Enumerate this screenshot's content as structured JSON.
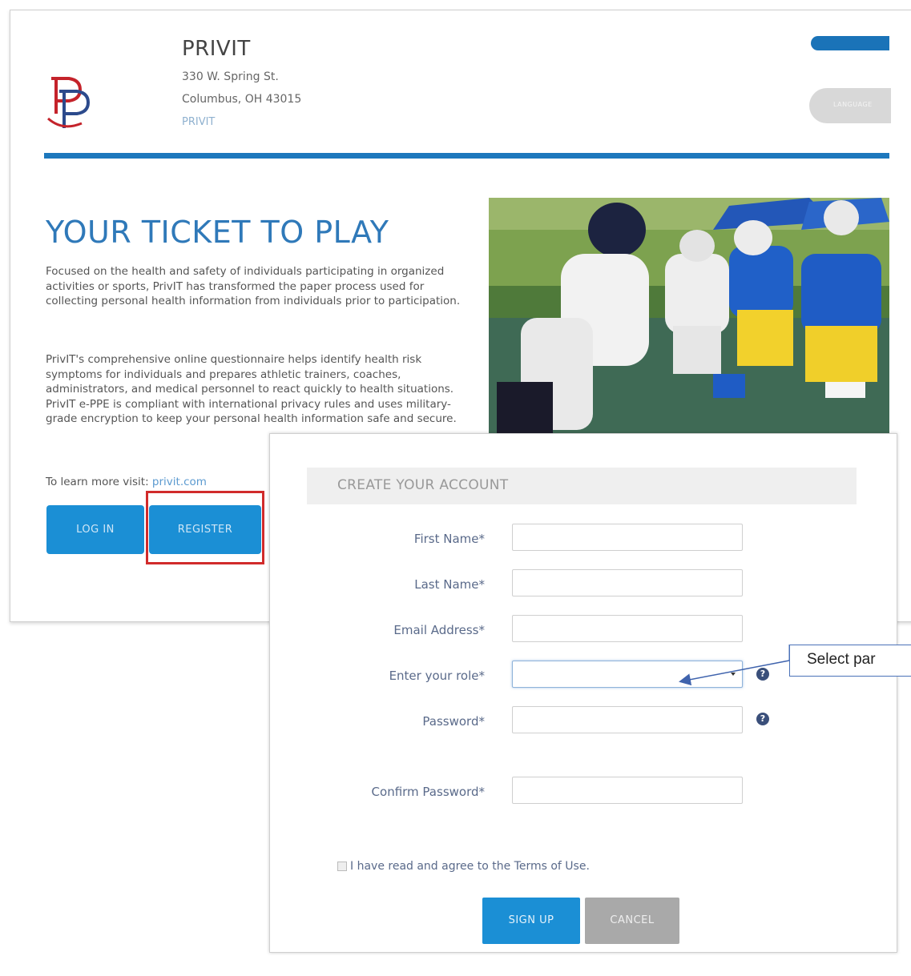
{
  "header": {
    "org_name": "PRIVIT",
    "address_line1": "330 W. Spring St.",
    "address_line2": "Columbus, OH 43015",
    "org_link": "PRIVIT",
    "top_grey_button": "LANGUAGE"
  },
  "hero": {
    "title": "YOUR TICKET TO PLAY",
    "paragraph1": "Focused on the health and safety of individuals participating in organized activities or sports, PrivIT has transformed the paper process used for collecting personal health information from individuals prior to participation.",
    "paragraph2": "PrivIT's comprehensive online questionnaire helps identify health risk symptoms for individuals and prepares athletic trainers, coaches, administrators, and medical personnel to react quickly to health situations. PrivIT e-PPE is compliant with international privacy rules and uses military-grade encryption to keep your personal health information safe and secure.",
    "learn_more_prefix": "To learn more visit: ",
    "learn_more_link": "privit.com"
  },
  "actions": {
    "login_label": "LOG IN",
    "register_label": "REGISTER"
  },
  "modal": {
    "title": "CREATE YOUR ACCOUNT",
    "fields": [
      {
        "label": "First Name*",
        "value": ""
      },
      {
        "label": "Last Name*",
        "value": ""
      },
      {
        "label": "Email Address*",
        "value": ""
      },
      {
        "label": "Enter your role*",
        "value": ""
      },
      {
        "label": "Password*",
        "value": ""
      },
      {
        "label": "Confirm Password*",
        "value": ""
      }
    ],
    "terms_label": "I have read and agree to the Terms of Use.",
    "signup_label": "SIGN UP",
    "cancel_label": "CANCEL"
  },
  "annotation": {
    "callout_text": "Select par"
  },
  "colors": {
    "brand_blue": "#1d78bd",
    "button_blue": "#1b8fd5",
    "highlight_red": "#d12b2b",
    "callout_border": "#4b72b8"
  }
}
